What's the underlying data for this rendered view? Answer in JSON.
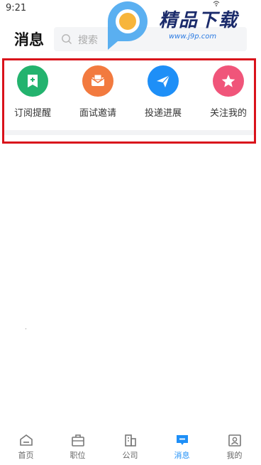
{
  "status": {
    "time": "9:21"
  },
  "header": {
    "title": "消息",
    "search_placeholder": "搜索"
  },
  "watermark": {
    "brand": "精品下载",
    "url": "www.j9p.com"
  },
  "shortcuts": [
    {
      "label": "订阅提醒",
      "icon": "bookmark-plus-icon",
      "color": "#23b36e"
    },
    {
      "label": "面试邀请",
      "icon": "envelope-icon",
      "color": "#f27a3f"
    },
    {
      "label": "投递进展",
      "icon": "paper-plane-icon",
      "color": "#1e8ff7"
    },
    {
      "label": "关注我的",
      "icon": "star-icon",
      "color": "#f0557a"
    }
  ],
  "tabbar": {
    "items": [
      {
        "label": "首页",
        "icon": "home-icon"
      },
      {
        "label": "职位",
        "icon": "briefcase-icon"
      },
      {
        "label": "公司",
        "icon": "building-icon"
      },
      {
        "label": "消息",
        "icon": "message-icon",
        "active": true
      },
      {
        "label": "我的",
        "icon": "profile-icon"
      }
    ]
  },
  "colors": {
    "accent": "#1e8ff7",
    "highlight_border": "#d9121b"
  }
}
